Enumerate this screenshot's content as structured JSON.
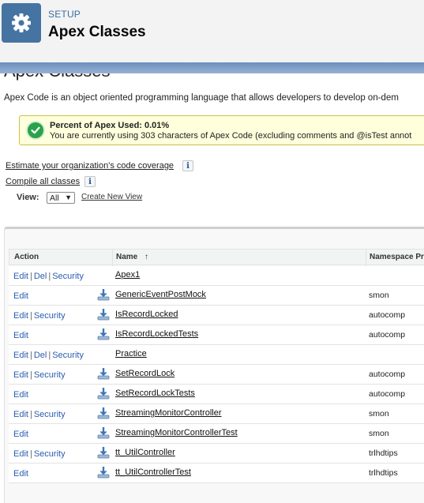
{
  "header": {
    "section": "SETUP",
    "title": "Apex Classes",
    "icon": "gear-icon"
  },
  "page": {
    "heading": "Apex Classes",
    "intro": "Apex Code is an object oriented programming language that allows developers to develop on-dem"
  },
  "usage": {
    "title": "Percent of Apex Used: 0.01%",
    "text": "You are currently using 303 characters of Apex Code (excluding comments and @isTest annot",
    "icon": "check-circle-icon",
    "color": "#2aa24a"
  },
  "links": {
    "estimate": "Estimate your organization's code coverage",
    "compile": "Compile all classes"
  },
  "view": {
    "label": "View:",
    "selected": "All",
    "create": "Create New View"
  },
  "table": {
    "columns": {
      "action": "Action",
      "name": "Name",
      "sort_indicator": "↑",
      "namespace": "Namespace Pr"
    },
    "rows": [
      {
        "actions": [
          "Edit",
          "Del",
          "Security"
        ],
        "download": false,
        "name": "Apex1",
        "namespace": ""
      },
      {
        "actions": [
          "Edit"
        ],
        "download": true,
        "name": "GenericEventPostMock",
        "namespace": "smon"
      },
      {
        "actions": [
          "Edit",
          "Security"
        ],
        "download": true,
        "name": "IsRecordLocked",
        "namespace": "autocomp"
      },
      {
        "actions": [
          "Edit"
        ],
        "download": true,
        "name": "IsRecordLockedTests",
        "namespace": "autocomp"
      },
      {
        "actions": [
          "Edit",
          "Del",
          "Security"
        ],
        "download": false,
        "name": "Practice",
        "namespace": ""
      },
      {
        "actions": [
          "Edit",
          "Security"
        ],
        "download": true,
        "name": "SetRecordLock",
        "namespace": "autocomp"
      },
      {
        "actions": [
          "Edit"
        ],
        "download": true,
        "name": "SetRecordLockTests",
        "namespace": "autocomp"
      },
      {
        "actions": [
          "Edit",
          "Security"
        ],
        "download": true,
        "name": "StreamingMonitorController",
        "namespace": "smon"
      },
      {
        "actions": [
          "Edit"
        ],
        "download": true,
        "name": "StreamingMonitorControllerTest",
        "namespace": "smon"
      },
      {
        "actions": [
          "Edit",
          "Security"
        ],
        "download": true,
        "name": "tt_UtilController",
        "namespace": "trlhdtips"
      },
      {
        "actions": [
          "Edit"
        ],
        "download": true,
        "name": "tt_UtilControllerTest",
        "namespace": "trlhdtips"
      }
    ]
  },
  "colors": {
    "header_icon_bg": "#4574a3",
    "link": "#2a5db0",
    "band": "#6c8fbb"
  }
}
